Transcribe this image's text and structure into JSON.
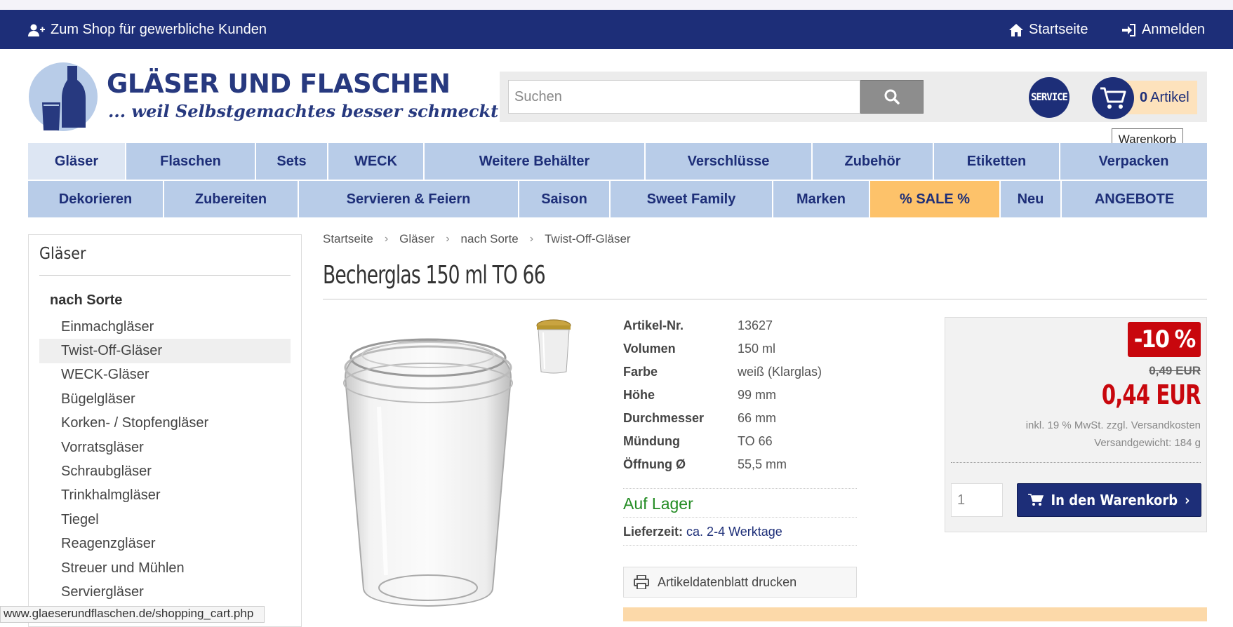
{
  "topbar": {
    "business_shop_label": "Zum Shop für gewerbliche Kunden",
    "home_label": "Startseite",
    "login_label": "Anmelden"
  },
  "logo": {
    "title": "GLÄSER UND FLASCHEN",
    "slogan": "... weil Selbstgemachtes besser schmeckt!"
  },
  "search": {
    "placeholder": "Suchen",
    "value": ""
  },
  "service_label": "SERVICE",
  "cart": {
    "count": "0",
    "label": "Artikel",
    "tooltip": "Warenkorb"
  },
  "nav_row1": [
    "Gläser",
    "Flaschen",
    "Sets",
    "WECK",
    "Weitere Behälter",
    "Verschlüsse",
    "Zubehör",
    "Etiketten",
    "Verpacken"
  ],
  "nav_row2": [
    "Dekorieren",
    "Zubereiten",
    "Servieren & Feiern",
    "Saison",
    "Sweet Family",
    "Marken",
    "% SALE %",
    "Neu",
    "ANGEBOTE"
  ],
  "sidebar": {
    "heading": "Gläser",
    "subheading": "nach Sorte",
    "items": [
      "Einmachgläser",
      "Twist-Off-Gläser",
      "WECK-Gläser",
      "Bügelgläser",
      "Korken- / Stopfengläser",
      "Vorratsgläser",
      "Schraubgläser",
      "Trinkhalmgläser",
      "Tiegel",
      "Reagenzgläser",
      "Streuer und Mühlen",
      "Serviergläser"
    ],
    "selected": "Twist-Off-Gläser"
  },
  "breadcrumb": [
    "Startseite",
    "Gläser",
    "nach Sorte",
    "Twist-Off-Gläser"
  ],
  "product": {
    "title": "Becherglas 150 ml TO 66",
    "specs": [
      {
        "label": "Artikel-Nr.",
        "value": "13627"
      },
      {
        "label": "Volumen",
        "value": "150 ml"
      },
      {
        "label": "Farbe",
        "value": "weiß (Klarglas)"
      },
      {
        "label": "Höhe",
        "value": "99 mm"
      },
      {
        "label": "Durchmesser",
        "value": "66 mm"
      },
      {
        "label": "Mündung",
        "value": "TO 66"
      },
      {
        "label": "Öffnung Ø",
        "value": "55,5 mm"
      }
    ],
    "stock": "Auf Lager",
    "delivery_label": "Lieferzeit:",
    "delivery_value": "ca. 2-4 Werktage",
    "print_label": "Artikeldatenblatt drucken"
  },
  "price": {
    "discount": "-10 %",
    "old": "0,49 EUR",
    "new": "0,44 EUR",
    "tax_note": "inkl. 19 % MwSt. zzgl. Versandkosten",
    "weight": "Versandgewicht: 184 g",
    "quantity": "1",
    "add_to_cart": "In den Warenkorb"
  },
  "status_url": "www.glaeserundflaschen.de/shopping_cart.php",
  "colors": {
    "brand_blue": "#1d2e78",
    "nav_blue": "#b8cce8",
    "sale_orange": "#fdc26a",
    "price_red": "#c8070d",
    "stock_green": "#228b22"
  }
}
